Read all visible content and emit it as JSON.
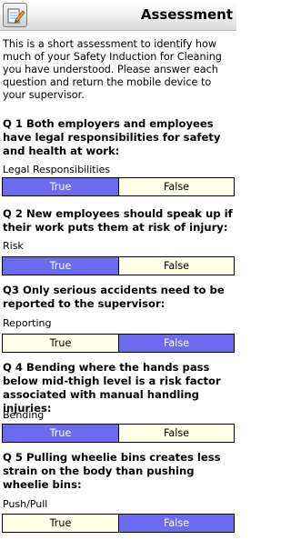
{
  "header": {
    "title": "Assessment",
    "app_icon": "notepad-pencil-icon"
  },
  "intro": "This is a short assessment to identify how much of your Safety Induction for Cleaning you have understood.  Please answer each question and return the mobile device to your supervisor.",
  "options": {
    "true_label": "True",
    "false_label": "False"
  },
  "colors": {
    "selected": "#6b6bf0",
    "unselected": "#ffffe6"
  },
  "questions": [
    {
      "text": "Q 1 Both employers and employees have legal responsibilities for safety and health at work:",
      "label": "Legal Responsibilities",
      "selected": "True"
    },
    {
      "text": "Q 2  New employees should speak up if their work puts them at risk of injury:",
      "label": "Risk",
      "selected": "True"
    },
    {
      "text": "Q3 Only serious accidents need to be reported to the supervisor:",
      "label": "Reporting",
      "selected": "False"
    },
    {
      "text": "Q 4 Bending where the hands pass below mid-thigh level is a risk factor associated with manual handling injuries:",
      "label": "Bending",
      "selected": "True"
    },
    {
      "text": "Q 5  Pulling wheelie bins creates less strain on the body than pushing wheelie bins:",
      "label": "Push/Pull",
      "selected": "False"
    }
  ]
}
